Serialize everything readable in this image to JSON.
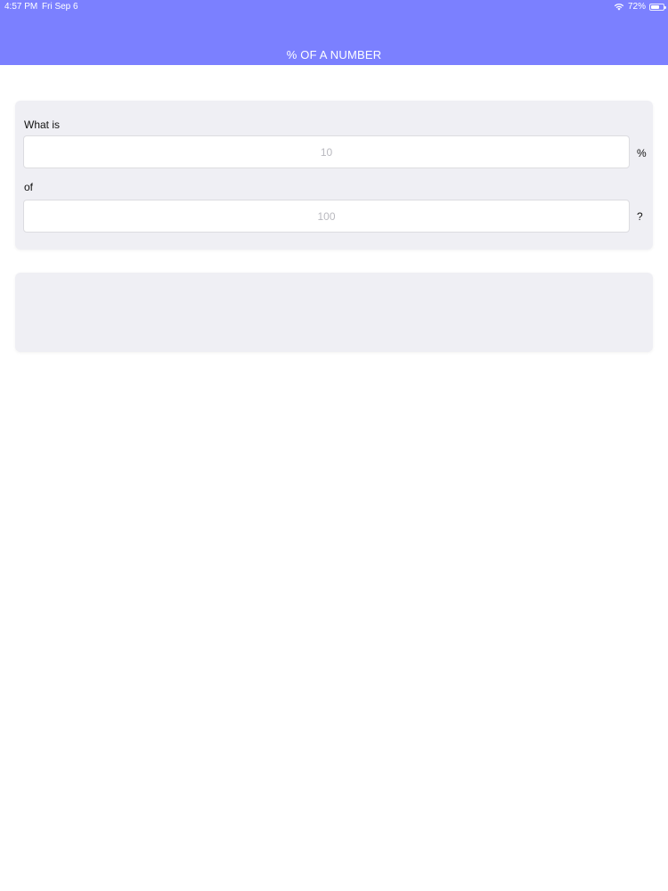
{
  "status_bar": {
    "time": "4:57 PM",
    "date": "Fri Sep 6",
    "battery_percent_label": "72%",
    "battery_level": 0.72
  },
  "header": {
    "title": "% OF A NUMBER",
    "color": "#7b80ff"
  },
  "calculator": {
    "what_is_label": "What is",
    "percent_field": {
      "value": "",
      "placeholder": "10"
    },
    "percent_suffix": "%",
    "of_label": "of",
    "number_field": {
      "value": "",
      "placeholder": "100"
    },
    "question_suffix": "?"
  },
  "result": {
    "text": ""
  }
}
